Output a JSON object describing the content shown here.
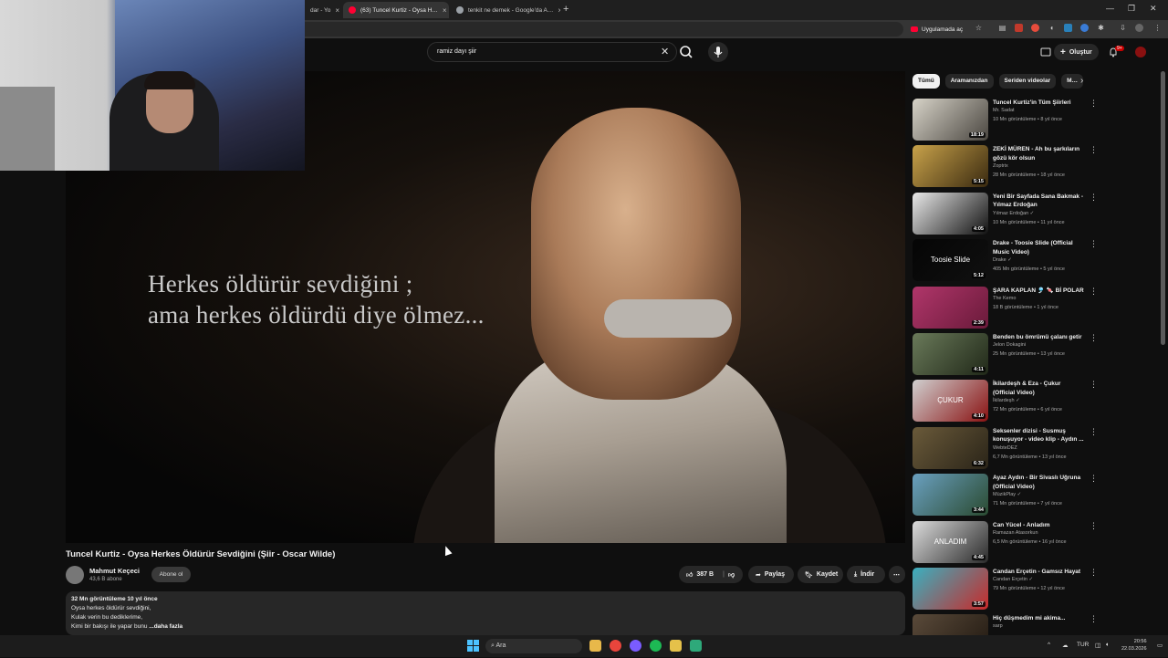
{
  "browser": {
    "tabs": [
      {
        "label": "dar - Yo",
        "active": false
      },
      {
        "label": "(63) Tuncel Kurtiz - Oysa H…",
        "active": true
      },
      {
        "label": "tenkit ne demek - Google'da A…",
        "active": false
      }
    ],
    "app_button_label": "Uygulamada aç"
  },
  "header": {
    "search_value": "ramiz dayı şiir",
    "create_label": "Oluştur",
    "notification_count": "9+"
  },
  "video": {
    "caption": "Herkes öldürür sevdiğini ;\nama herkes öldürdü diye ölmez...",
    "title": "Tuncel Kurtiz - Oysa Herkes Öldürür Sevdiğini (Şiir - Oscar Wilde)",
    "channel_name": "Mahmut Keçeci",
    "channel_subs": "43,6 B abone",
    "subscribe_label": "Abone ol",
    "like_count": "387 B",
    "share_label": "Paylaş",
    "save_label": "Kaydet",
    "download_label": "İndir",
    "description": {
      "meta": "32 Mn görüntüleme  10 yıl önce",
      "lines": [
        "Oysa herkes öldürür sevdiğini,",
        "Kulak verin bu dediklerime,",
        "Kimi bir bakışı ile yapar bunu"
      ],
      "more": "...daha fazla"
    }
  },
  "sidebar": {
    "chips": [
      "Tümü",
      "Aramanızdan",
      "Seriden videolar",
      "M…"
    ],
    "recommendations": [
      {
        "title": "Tuncel Kurtiz'in Tüm Şiirleri",
        "channel": "Mr. Sadat",
        "meta": "10 Mn görüntüleme • 8 yıl önce",
        "duration": "18:19",
        "thumb": [
          "#d7d3c8",
          "#4a4640"
        ]
      },
      {
        "title": "ZEKİ MÜREN - Ah bu şarkıların gözü kör olsun",
        "channel": "Zoptrix",
        "meta": "28 Mn görüntüleme • 18 yıl önce",
        "duration": "5:15",
        "thumb": [
          "#c8a24a",
          "#3a2a10"
        ]
      },
      {
        "title": "Yeni Bir Sayfada Sana Bakmak - Yılmaz Erdoğan",
        "channel": "Yılmaz Erdoğan ✓",
        "meta": "10 Mn görüntüleme • 11 yıl önce",
        "duration": "4:05",
        "thumb": [
          "#e9e9e9",
          "#111111"
        ]
      },
      {
        "title": "Drake - Toosie Slide (Official Music Video)",
        "channel": "Drake ✓",
        "meta": "405 Mn görüntüleme • 5 yıl önce",
        "duration": "5:12",
        "thumb": [
          "#050505",
          "#101010"
        ],
        "thumb_text": "Toosie Slide"
      },
      {
        "title": "ŞARA KAPLAN 🎐 🍬 Bİ POLAR",
        "channel": "The Kemo",
        "meta": "18 B görüntüleme • 1 yıl önce",
        "duration": "2:39",
        "thumb": [
          "#b0366a",
          "#6a1a3a"
        ]
      },
      {
        "title": "Benden bu ömrümü çalanı getir",
        "channel": "Jelon Dokagini",
        "meta": "25 Mn görüntüleme • 13 yıl önce",
        "duration": "4:11",
        "thumb": [
          "#6a7a5a",
          "#202818"
        ]
      },
      {
        "title": "İkilardeşh & Eza - Çukur (Official Video)",
        "channel": "İkilardeşh ✓",
        "meta": "72 Mn görüntüleme • 6 yıl önce",
        "duration": "4:10",
        "thumb": [
          "#d0d0d0",
          "#8a1212"
        ],
        "thumb_text": "ÇUKUR"
      },
      {
        "title": "Seksenler dizisi - Susmuş konuşuyor - video klip - Aydın ...",
        "channel": "WebteDEZ",
        "meta": "6,7 Mn görüntüleme • 13 yıl önce",
        "duration": "6:32",
        "thumb": [
          "#6a5a3a",
          "#2a2418"
        ]
      },
      {
        "title": "Ayaz Aydın - Bir Sivaslı Uğruna (Official Video)",
        "channel": "MüzikPlay ✓",
        "meta": "71 Mn görüntüleme • 7 yıl önce",
        "duration": "3:44",
        "thumb": [
          "#6aa0c0",
          "#2a4a30"
        ]
      },
      {
        "title": "Can Yücel - Anladım",
        "channel": "Ramazan Atasorkun",
        "meta": "6,5 Mn görüntüleme • 16 yıl önce",
        "duration": "4:45",
        "thumb": [
          "#dcdcdc",
          "#2a2a2a"
        ],
        "thumb_text": "ANLADIM"
      },
      {
        "title": "Candan Erçetin - Gamsız Hayat",
        "channel": "Candan Erçetin ✓",
        "meta": "79 Mn görüntüleme • 12 yıl önce",
        "duration": "3:57",
        "thumb": [
          "#3ab0c0",
          "#c82a2a"
        ]
      },
      {
        "title": "Hiç düşmedim mi akima...",
        "channel": "sarp",
        "meta": "",
        "duration": "",
        "thumb": [
          "#5a4a3a",
          "#201810"
        ]
      }
    ]
  },
  "taskbar": {
    "search_placeholder": "Ara",
    "lang": "TUR",
    "time": "20:56",
    "date": "22.03.2026"
  },
  "colors": {
    "accent": "#cc0000",
    "background": "#0f0f0f",
    "surface": "#272727"
  }
}
